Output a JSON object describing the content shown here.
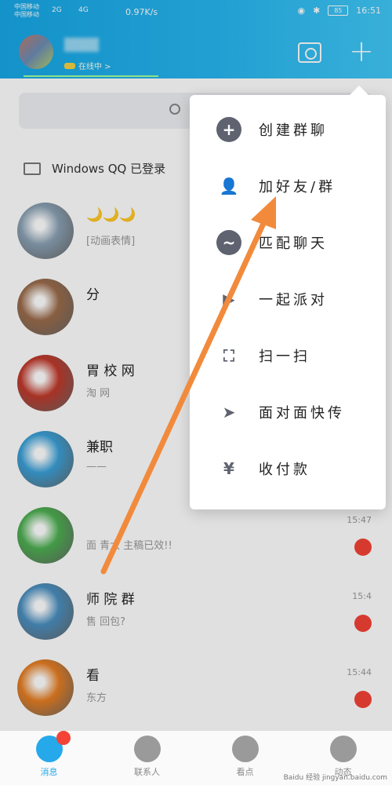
{
  "status_bar": {
    "carrier1": "中国移动",
    "carrier2": "中国移动",
    "net1": "2G",
    "net2": "4G",
    "speed": "0.97K/s",
    "battery": "85",
    "time": "16:51"
  },
  "header": {
    "status_text": "在线中 >"
  },
  "pc_login": "Windows QQ 已登录",
  "chats": [
    {
      "title": "🌙🌙🌙",
      "sub": "[动画表情]",
      "time": "",
      "color": "#8aa1b4"
    },
    {
      "title": "分",
      "sub": "",
      "time": "",
      "color": "#9b6b4a"
    },
    {
      "title": "胃 校 网",
      "sub": "淘 网",
      "time": "",
      "color": "#c0392b"
    },
    {
      "title": "兼职",
      "sub": "——",
      "time": "",
      "color": "#3aa0d8"
    },
    {
      "title": "",
      "sub": "面 青大 主稿已效!!",
      "time": "15:47",
      "color": "#4caf50"
    },
    {
      "title": "师 院 群",
      "sub": "售 回包?",
      "time": "15:4",
      "color": "#4a8fc0"
    },
    {
      "title": "看",
      "sub": "东方",
      "time": "15:44",
      "color": "#e67e22"
    }
  ],
  "tabs": [
    {
      "label": "消息"
    },
    {
      "label": "联系人"
    },
    {
      "label": "看点"
    },
    {
      "label": "动态"
    }
  ],
  "menu": [
    {
      "icon": "plus-chat-icon",
      "label": "创建群聊"
    },
    {
      "icon": "add-friend-icon",
      "label": "加好友/群"
    },
    {
      "icon": "match-chat-icon",
      "label": "匹配聊天"
    },
    {
      "icon": "party-icon",
      "label": "一起派对"
    },
    {
      "icon": "scan-icon",
      "label": "扫一扫"
    },
    {
      "icon": "send-icon",
      "label": "面对面快传"
    },
    {
      "icon": "payment-icon",
      "label": "收付款"
    }
  ],
  "watermark": "Baidu 经验  jingyan.baidu.com",
  "colors": {
    "accent": "#26a9ea",
    "arrow": "#f28a3c"
  }
}
